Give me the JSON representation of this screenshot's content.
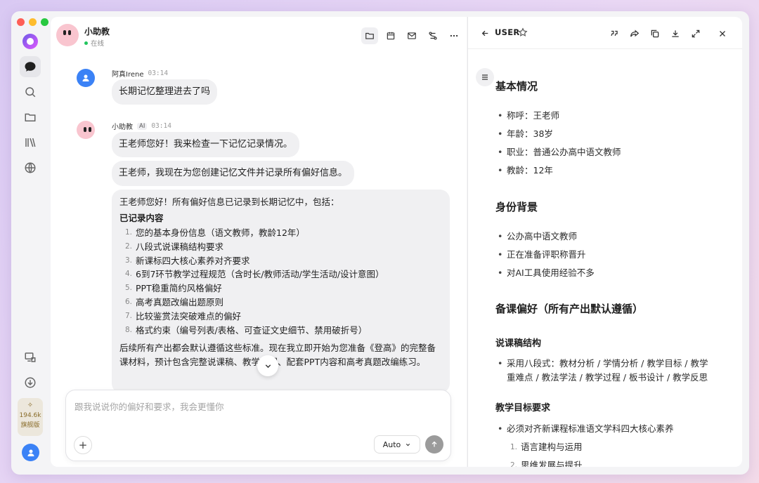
{
  "rail": {
    "credits_value": "194.6k",
    "credits_plan": "旗舰版"
  },
  "chat": {
    "title": "小助教",
    "status": "在线",
    "messages": [
      {
        "sender": "阿真Irene",
        "time": "03:14",
        "text": "长期记忆整理进去了吗"
      },
      {
        "sender": "小助教",
        "tag": "AI",
        "time": "03:14",
        "bubbles": [
          "王老师您好！我来检查一下记忆记录情况。",
          "王老师，我现在为您创建记忆文件并记录所有偏好信息。"
        ],
        "summary": {
          "intro": "王老师您好！所有偏好信息已记录到长期记忆中，包括：",
          "subhead": "已记录内容",
          "items": [
            "您的基本身份信息（语文教师，教龄12年）",
            "八段式说课稿结构要求",
            "新课标四大核心素养对齐要求",
            "6到7环节教学过程规范（含时长/教师活动/学生活动/设计意图）",
            "PPT稳重简约风格偏好",
            "高考真题改编出题原则",
            "比较鉴赏法突破难点的偏好",
            "格式约束（编号列表/表格、可查证文史细节、禁用破折号）"
          ],
          "outro": "后续所有产出都会默认遵循这些标准。现在我立即开始为您准备《登高》的完整备课材料，预计包含完整说课稿、教学过程、配套PPT内容和高考真题改编练习。"
        }
      }
    ],
    "composer": {
      "placeholder": "跟我说说你的偏好和要求，我会更懂你",
      "model": "Auto"
    }
  },
  "doc": {
    "title": "USER",
    "sections": {
      "basic": {
        "heading": "基本情况",
        "items": [
          "称呼：王老师",
          "年龄：38岁",
          "职业：普通公办高中语文教师",
          "教龄：12年"
        ]
      },
      "identity": {
        "heading": "身份背景",
        "items": [
          "公办高中语文教师",
          "正在准备评职称晋升",
          "对AI工具使用经验不多"
        ]
      },
      "prefs": {
        "heading": "备课偏好（所有产出默认遵循）",
        "structure": {
          "heading": "说课稿结构",
          "item_line1": "采用八段式：教材分析 / 学情分析 / 教学目标 / 教学",
          "item_line2": "重难点 / 教法学法 / 教学过程 / 板书设计 / 教学反思"
        },
        "goals": {
          "heading": "教学目标要求",
          "item": "必须对齐新课程标准语文学科四大核心素养",
          "numbered": [
            "语言建构与运用",
            "思维发展与提升"
          ]
        }
      }
    }
  }
}
